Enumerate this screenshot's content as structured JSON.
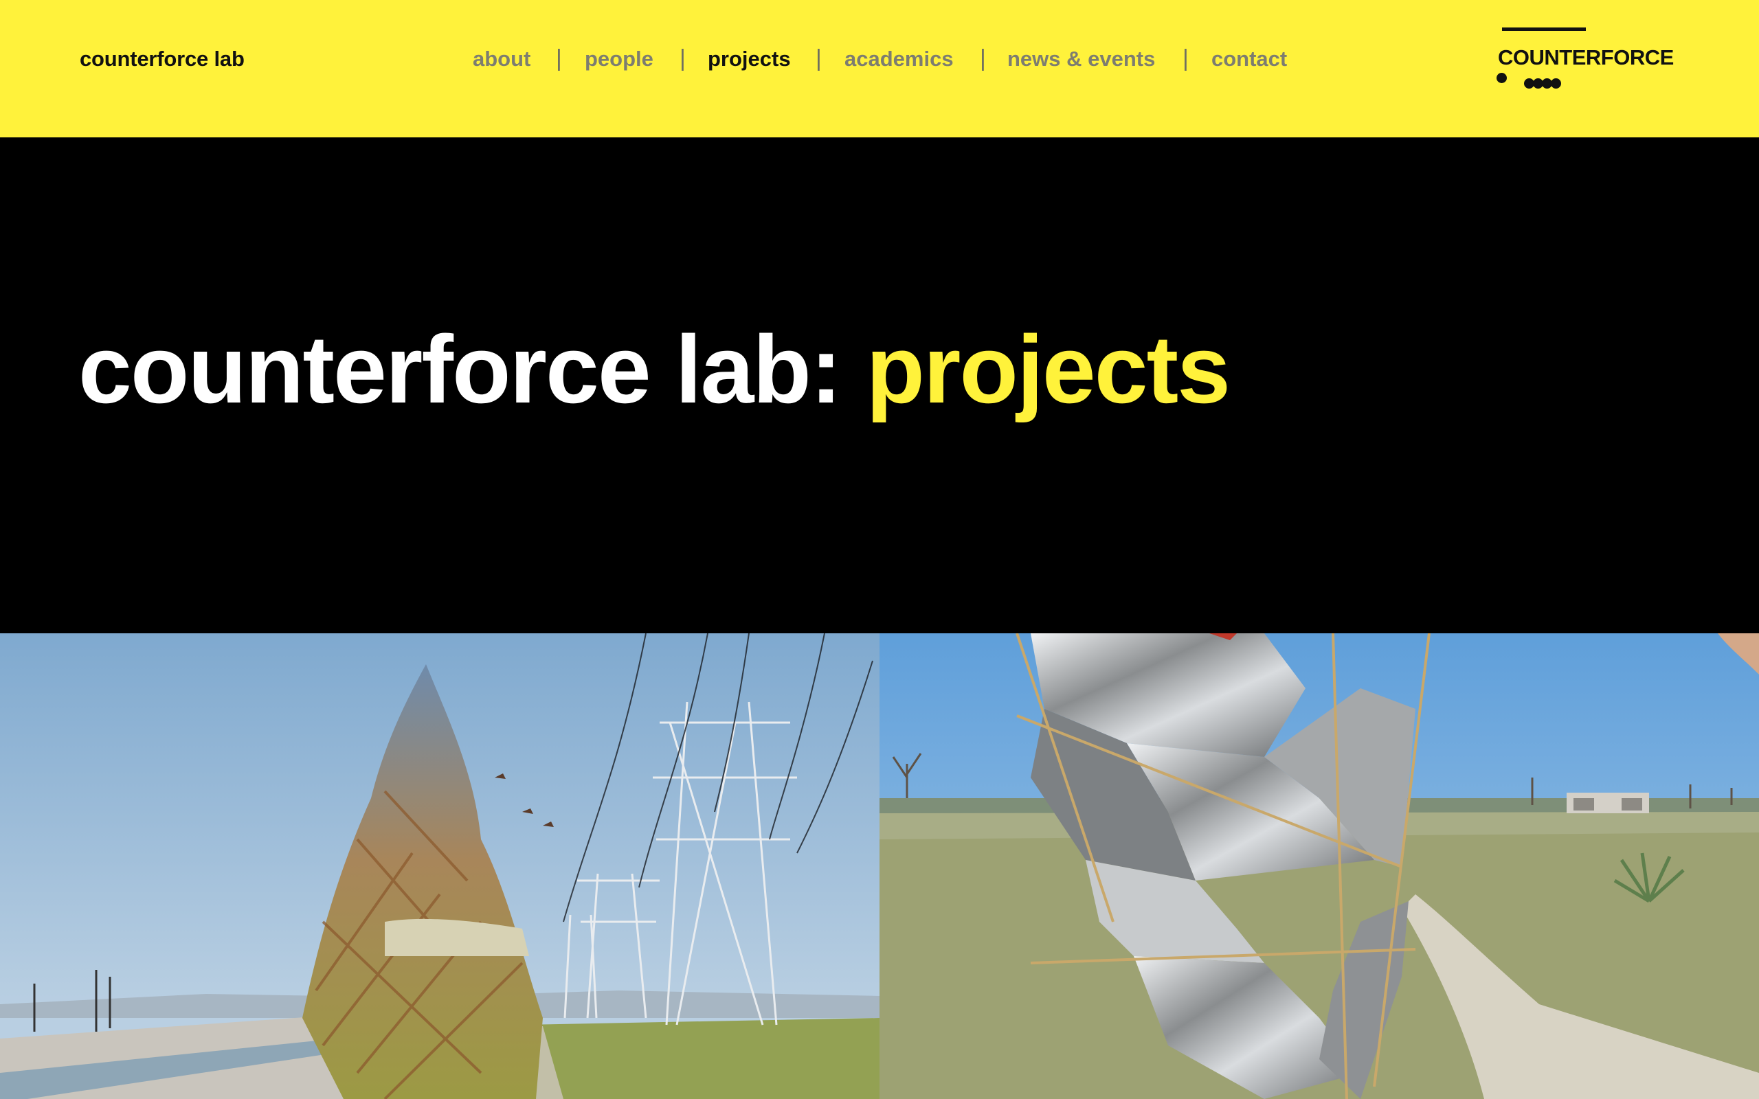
{
  "header": {
    "site_name": "counterforce lab",
    "nav": [
      {
        "label": "about",
        "active": false
      },
      {
        "label": "people",
        "active": false
      },
      {
        "label": "projects",
        "active": true
      },
      {
        "label": "academics",
        "active": false
      },
      {
        "label": "news & events",
        "active": false
      },
      {
        "label": "contact",
        "active": false
      }
    ],
    "separator": "|",
    "logo_text": "COUNTERFORCE",
    "accent_color": "#FFF23B"
  },
  "hero": {
    "title_prefix": "counterforce lab:",
    "title_highlight": "projects"
  },
  "projects": [
    {
      "image": "tower-installation-river-channel-powerlines-photo"
    },
    {
      "image": "mirror-foil-kite-structure-in-grassland-photo"
    }
  ]
}
